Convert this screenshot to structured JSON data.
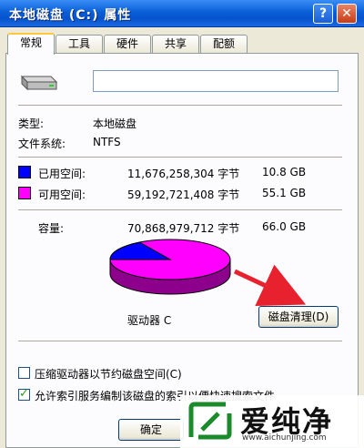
{
  "window": {
    "title": "本地磁盘 (C:) 属性",
    "help_label": "?",
    "close_label": "✕"
  },
  "tabs": [
    {
      "label": "常规"
    },
    {
      "label": "工具"
    },
    {
      "label": "硬件"
    },
    {
      "label": "共享"
    },
    {
      "label": "配额"
    }
  ],
  "general": {
    "volume_label_value": "",
    "type_label": "类型:",
    "type_value": "本地磁盘",
    "fs_label": "文件系统:",
    "fs_value": "NTFS",
    "used": {
      "label": "已用空间:",
      "bytes": "11,676,258,304 字节",
      "size": "10.8 GB",
      "color": "#0000ff"
    },
    "free": {
      "label": "可用空间:",
      "bytes": "59,192,721,408 字节",
      "size": "55.1 GB",
      "color": "#ff00ff"
    },
    "capacity": {
      "label": "容量:",
      "bytes": "70,868,979,712 字节",
      "size": "66.0 GB"
    },
    "used_fraction": 0.1648,
    "drive_label": "驱动器 C",
    "cleanup_button": "磁盘清理(D)",
    "compress_label": "压缩驱动器以节约磁盘空间(C)",
    "compress_checked": false,
    "index_label": "允许索引服务编制该磁盘的索引以便快速搜索文件",
    "index_checked": true
  },
  "footer": {
    "ok_label": "确定"
  },
  "watermark": {
    "brand": "爱纯净",
    "url": "www.aichunjing.com"
  },
  "colors": {
    "accent_arrow": "#e8212e",
    "title_bar": "#0a5fd8"
  }
}
